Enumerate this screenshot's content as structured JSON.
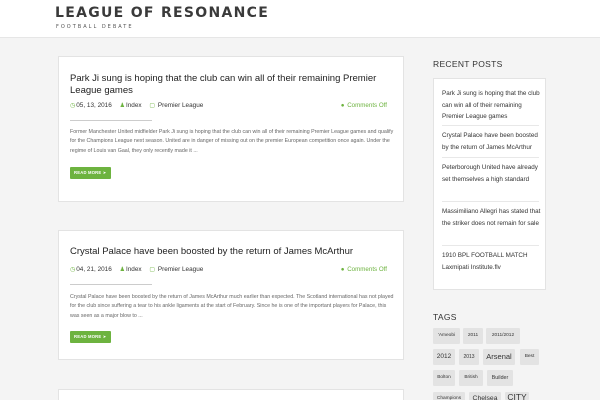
{
  "site": {
    "title": "LEAGUE OF RESONANCE",
    "tagline": "FOOTBALL DEBATE"
  },
  "posts": [
    {
      "title": "Park Ji sung is hoping that the club can win all of their remaining Premier League games",
      "date": "05, 13, 2016",
      "author": "Index",
      "category": "Premier League",
      "comments": "Comments Off",
      "excerpt": "Former Manchester United midfielder Park Ji sung is hoping that the club can win all of their remaining Premier League games and qualify for the Champions League next season. United are in danger of missing out on the premier European competition once again. Under the regime of Louis van Gaal, they only recently made it ...",
      "read_more": "READ MORE"
    },
    {
      "title": "Crystal Palace have been boosted by the return of James McArthur",
      "date": "04, 21, 2016",
      "author": "Index",
      "category": "Premier League",
      "comments": "Comments Off",
      "excerpt": "Crystal Palace have been boosted by the return of James McArthur much earlier than expected. The Scotland international has not played for the club since suffering a tear to his ankle ligaments at the start of February. Since he is one of the important players for Palace, this was seen as a major blow to ...",
      "read_more": "READ MORE"
    }
  ],
  "sidebar": {
    "recent_title": "RECENT POSTS",
    "recent_posts": [
      "Park Ji sung is hoping that the club can win all of their remaining Premier League games",
      "Crystal Palace have been boosted by the return of James McArthur",
      "Peterborough United have already set themselves a high standard",
      "Massimiliano Allegri has stated that the striker does not remain for sale",
      "1910 BPL FOOTBALL MATCH Laxmipati Institute.flv"
    ],
    "tags_title": "TAGS",
    "tags": [
      "'Ameobi",
      "2011",
      "2011/2012",
      "2012",
      "2013",
      "Arsenal",
      "Best",
      "Bolton",
      "British",
      "Builder",
      "Champions",
      "Chelsea",
      "CITY"
    ]
  },
  "colors": {
    "accent": "#6db33f",
    "background": "#f4f4f4",
    "tag_bg": "#e3e3e3"
  },
  "icons": {
    "date": "clock-icon",
    "author": "user-icon",
    "category": "folder-icon",
    "comments": "comment-icon",
    "read_more": "circle-arrow-icon"
  }
}
